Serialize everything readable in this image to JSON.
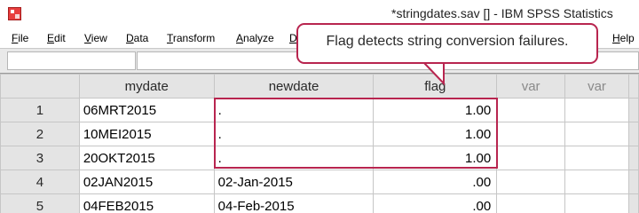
{
  "window": {
    "title": "*stringdates.sav [] - IBM SPSS Statistics"
  },
  "menu": [
    "File",
    "Edit",
    "View",
    "Data",
    "Transform",
    "Analyze",
    "D",
    "Help"
  ],
  "menu_underline": [
    "F",
    "E",
    "V",
    "D",
    "T",
    "A",
    "D",
    "H"
  ],
  "grid": {
    "columns": [
      "mydate",
      "newdate",
      "flag",
      "var",
      "var"
    ],
    "rows": [
      {
        "num": "1",
        "mydate": "06MRT2015",
        "newdate": ".",
        "flag": "1.00"
      },
      {
        "num": "2",
        "mydate": "10MEI2015",
        "newdate": ".",
        "flag": "1.00"
      },
      {
        "num": "3",
        "mydate": "20OKT2015",
        "newdate": ".",
        "flag": "1.00"
      },
      {
        "num": "4",
        "mydate": "02JAN2015",
        "newdate": "02-Jan-2015",
        "flag": ".00"
      },
      {
        "num": "5",
        "mydate": "04FEB2015",
        "newdate": "04-Feb-2015",
        "flag": ".00"
      }
    ]
  },
  "callout": {
    "text": "Flag detects string conversion failures."
  },
  "colors": {
    "annotation": "#b8254f",
    "header_bg": "#e4e4e4",
    "gridline": "#c6c6c6"
  }
}
